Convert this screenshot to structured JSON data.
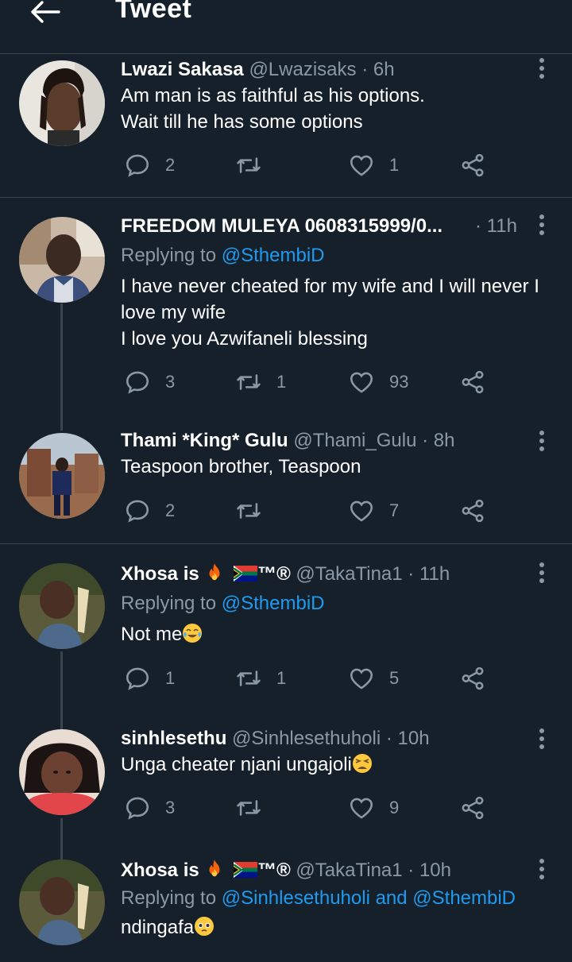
{
  "header": {
    "title": "Tweet"
  },
  "tweets": [
    {
      "name": "Lwazi Sakasa",
      "handle": "@Lwazisaks",
      "time": "· 6h",
      "lines": [
        "Am man is as faithful as his options.",
        "Wait till he has some options"
      ],
      "replies": "2",
      "retweets": "",
      "likes": "1"
    },
    {
      "name": "FREEDOM MULEYA 0608315999/0...",
      "handle": "",
      "time": "· 11h",
      "replying_prefix": "Replying to ",
      "replying_to": "@SthembiD",
      "lines": [
        "I have never cheated for my wife and I will never I",
        "love my wife",
        "I love you Azwifaneli blessing"
      ],
      "replies": "3",
      "retweets": "1",
      "likes": "93"
    },
    {
      "name": "Thami *King* Gulu",
      "handle": "@Thami_Gulu",
      "time": "· 8h",
      "lines": [
        "Teaspoon brother, Teaspoon"
      ],
      "replies": "2",
      "retweets": "",
      "likes": "7"
    },
    {
      "name": "Xhosa is",
      "name_suffix": "™®",
      "handle": "@TakaTina1",
      "time": "· 11h",
      "replying_prefix": "Replying to ",
      "replying_to": "@SthembiD",
      "lines": [
        "Not me"
      ],
      "replies": "1",
      "retweets": "1",
      "likes": "5"
    },
    {
      "name": "sinhlesethu",
      "handle": "@Sinhlesethuholi",
      "time": "· 10h",
      "lines": [
        "Unga cheater njani ungajoli"
      ],
      "replies": "3",
      "retweets": "",
      "likes": "9"
    },
    {
      "name": "Xhosa is",
      "name_suffix": "™®",
      "handle": "@TakaTina1",
      "time": "· 10h",
      "replying_prefix": "Replying to ",
      "replying_to": "@Sinhlesethuholi and @SthembiD",
      "lines": [
        "ndingafa"
      ]
    }
  ]
}
